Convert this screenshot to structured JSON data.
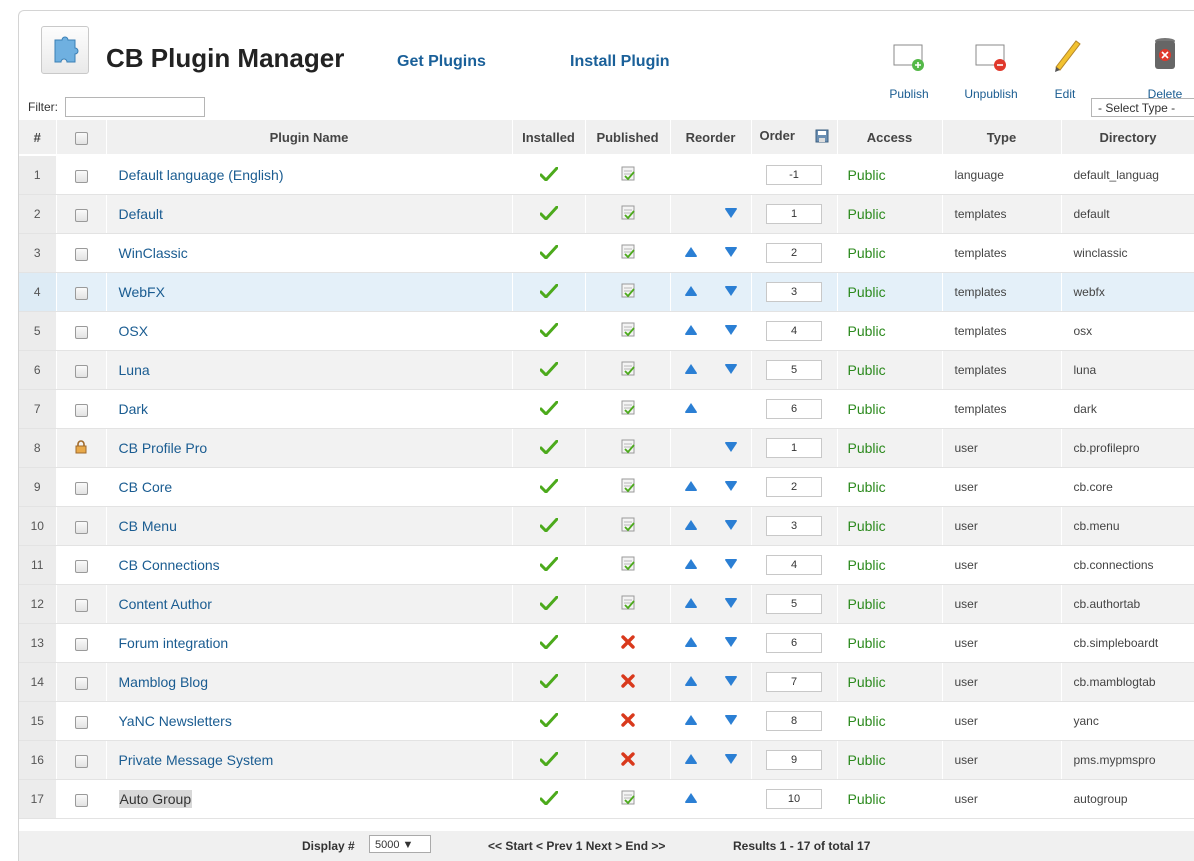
{
  "header": {
    "title": "CB Plugin Manager",
    "get_plugins": "Get Plugins",
    "install_plugin": "Install Plugin",
    "logo_icon": "puzzle-piece-icon"
  },
  "toolbar": {
    "publish": "Publish",
    "unpublish": "Unpublish",
    "edit": "Edit",
    "delete": "Delete"
  },
  "filter": {
    "label": "Filter:",
    "value": "",
    "type_select": "- Select Type -"
  },
  "columns": [
    "#",
    "",
    "Plugin Name",
    "Installed",
    "Published",
    "Reorder",
    "Order",
    "Access",
    "Type",
    "Directory"
  ],
  "rows": [
    {
      "num": "1",
      "name": "Default language (English)",
      "published": true,
      "up": false,
      "down": false,
      "order": "-1",
      "access": "Public",
      "type": "language",
      "dir": "default_languag",
      "locked": false
    },
    {
      "num": "2",
      "name": "Default",
      "published": true,
      "up": false,
      "down": true,
      "order": "1",
      "access": "Public",
      "type": "templates",
      "dir": "default",
      "locked": false
    },
    {
      "num": "3",
      "name": "WinClassic",
      "published": true,
      "up": true,
      "down": true,
      "order": "2",
      "access": "Public",
      "type": "templates",
      "dir": "winclassic",
      "locked": false
    },
    {
      "num": "4",
      "name": "WebFX",
      "published": true,
      "up": true,
      "down": true,
      "order": "3",
      "access": "Public",
      "type": "templates",
      "dir": "webfx",
      "locked": false
    },
    {
      "num": "5",
      "name": "OSX",
      "published": true,
      "up": true,
      "down": true,
      "order": "4",
      "access": "Public",
      "type": "templates",
      "dir": "osx",
      "locked": false
    },
    {
      "num": "6",
      "name": "Luna",
      "published": true,
      "up": true,
      "down": true,
      "order": "5",
      "access": "Public",
      "type": "templates",
      "dir": "luna",
      "locked": false
    },
    {
      "num": "7",
      "name": "Dark",
      "published": true,
      "up": true,
      "down": false,
      "order": "6",
      "access": "Public",
      "type": "templates",
      "dir": "dark",
      "locked": false
    },
    {
      "num": "8",
      "name": "CB Profile Pro",
      "published": true,
      "up": false,
      "down": true,
      "order": "1",
      "access": "Public",
      "type": "user",
      "dir": "cb.profilepro",
      "locked": true
    },
    {
      "num": "9",
      "name": "CB Core",
      "published": true,
      "up": true,
      "down": true,
      "order": "2",
      "access": "Public",
      "type": "user",
      "dir": "cb.core",
      "locked": false
    },
    {
      "num": "10",
      "name": "CB Menu",
      "published": true,
      "up": true,
      "down": true,
      "order": "3",
      "access": "Public",
      "type": "user",
      "dir": "cb.menu",
      "locked": false
    },
    {
      "num": "11",
      "name": "CB Connections",
      "published": true,
      "up": true,
      "down": true,
      "order": "4",
      "access": "Public",
      "type": "user",
      "dir": "cb.connections",
      "locked": false
    },
    {
      "num": "12",
      "name": "Content Author",
      "published": true,
      "up": true,
      "down": true,
      "order": "5",
      "access": "Public",
      "type": "user",
      "dir": "cb.authortab",
      "locked": false
    },
    {
      "num": "13",
      "name": "Forum integration",
      "published": false,
      "up": true,
      "down": true,
      "order": "6",
      "access": "Public",
      "type": "user",
      "dir": "cb.simpleboardt",
      "locked": false
    },
    {
      "num": "14",
      "name": "Mamblog Blog",
      "published": false,
      "up": true,
      "down": true,
      "order": "7",
      "access": "Public",
      "type": "user",
      "dir": "cb.mamblogtab",
      "locked": false
    },
    {
      "num": "15",
      "name": "YaNC Newsletters",
      "published": false,
      "up": true,
      "down": true,
      "order": "8",
      "access": "Public",
      "type": "user",
      "dir": "yanc",
      "locked": false
    },
    {
      "num": "16",
      "name": "Private Message System",
      "published": false,
      "up": true,
      "down": true,
      "order": "9",
      "access": "Public",
      "type": "user",
      "dir": "pms.mypmspro",
      "locked": false
    },
    {
      "num": "17",
      "name": "Auto Group",
      "published": true,
      "up": true,
      "down": false,
      "order": "10",
      "access": "Public",
      "type": "user",
      "dir": "autogroup",
      "locked": false
    }
  ],
  "footer": {
    "display_label": "Display #",
    "display_value": "5000 ▼",
    "pager": "<< Start < Prev 1 Next > End >>",
    "results": "Results 1 - 17 of total 17"
  },
  "colors": {
    "link": "#1a5c91",
    "access": "#2c8a1e",
    "check": "#4caa1c",
    "cross": "#d9391c",
    "arrow": "#2b7fd4"
  }
}
